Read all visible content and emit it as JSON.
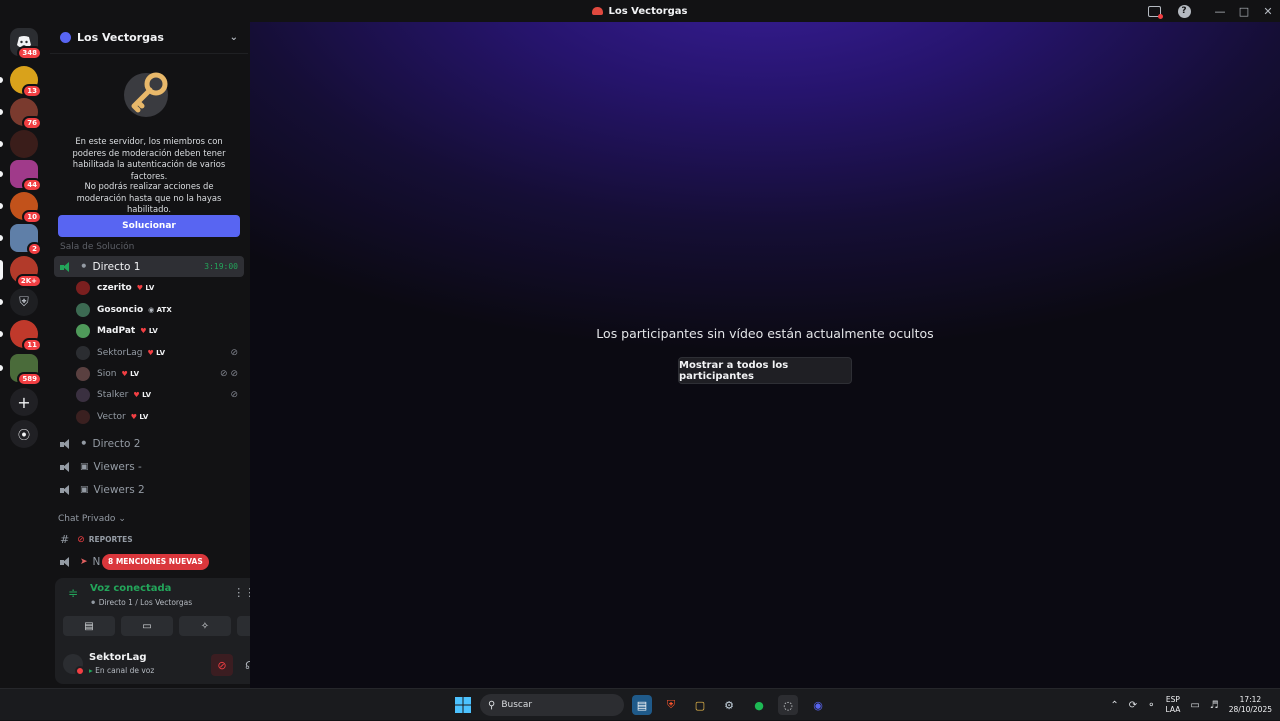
{
  "window": {
    "title": "Los Vectorgas"
  },
  "guilds": [
    {
      "badge": "348"
    },
    {
      "badge": "13"
    },
    {
      "badge": "76"
    },
    {
      "badge": ""
    },
    {
      "badge": "44"
    },
    {
      "badge": "10"
    },
    {
      "badge": "2"
    },
    {
      "badge": "2K+"
    },
    {
      "badge": ""
    },
    {
      "badge": "11"
    },
    {
      "badge": "589"
    }
  ],
  "server": {
    "name": "Los Vectorgas"
  },
  "mfa": {
    "text1": "En este servidor, los miembros con poderes de moderación deben tener habilitada la autenticación de varios factores.",
    "text2": "No podrás realizar acciones de moderación hasta que no la hayas habilitado.",
    "button": "Solucionar"
  },
  "channels": {
    "partial": "Sala de Solución",
    "active": {
      "name": "Directo 1",
      "timer": "3:19:00"
    },
    "others": [
      {
        "name": "Directo 2"
      },
      {
        "name": "Viewers -"
      },
      {
        "name": "Viewers 2"
      }
    ]
  },
  "members": [
    {
      "name": "czerito",
      "tag": "LV",
      "active": true
    },
    {
      "name": "Gosoncio",
      "tag": "ATX",
      "active": true
    },
    {
      "name": "MadPat",
      "tag": "LV",
      "active": true
    },
    {
      "name": "SektorLag",
      "tag": "LV",
      "active": false
    },
    {
      "name": "Sion",
      "tag": "LV",
      "active": false
    },
    {
      "name": "Stalker",
      "tag": "LV",
      "active": false
    },
    {
      "name": "Vector",
      "tag": "LV",
      "active": false
    }
  ],
  "private_category": {
    "label": "Chat Privado",
    "text_channel": "REPORTES",
    "voice_prefix": "N",
    "mentions_pill": "8 MENCIONES NUEVAS"
  },
  "voice": {
    "status": "Voz conectada",
    "location": "Directo 1 / Los Vectorgas"
  },
  "user": {
    "name": "SektorLag",
    "status": "En canal de voz"
  },
  "stage": {
    "message": "Los participantes sin vídeo están actualmente ocultos",
    "button": "Mostrar a todos los participantes",
    "colors": {
      "top": "#3b1f9e",
      "bottom": "#0b0a12"
    }
  },
  "taskbar": {
    "search": "Buscar",
    "lang_top": "ESP",
    "lang_bottom": "LAA",
    "time": "17:12",
    "date": "28/10/2025"
  },
  "colors": {
    "accent": "#5865f2",
    "green": "#23a55a",
    "red": "#f23f43"
  }
}
